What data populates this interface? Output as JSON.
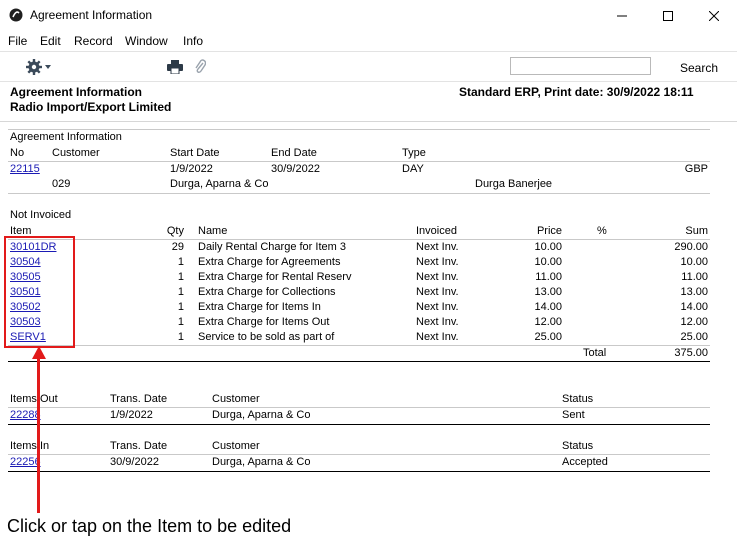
{
  "window": {
    "title": "Agreement Information"
  },
  "menu": [
    "File",
    "Edit",
    "Record",
    "Window",
    "Info"
  ],
  "toolbar": {
    "search_label": "Search",
    "search_value": ""
  },
  "header": {
    "left1": "Agreement Information",
    "left2": "Radio Import/Export Limited",
    "right": "Standard ERP, Print date: 30/9/2022 18:11"
  },
  "agreement": {
    "section_title": "Agreement Information",
    "cols": {
      "no": "No",
      "customer": "Customer",
      "start": "Start Date",
      "end": "End Date",
      "type": "Type"
    },
    "no": "22115",
    "start": "1/9/2022",
    "end": "30/9/2022",
    "type": "DAY",
    "currency": "GBP",
    "customer_code": "029",
    "customer_name": "Durga, Aparna & Co",
    "contact": "Durga Banerjee"
  },
  "not_invoiced": {
    "section_title": "Not Invoiced",
    "cols": {
      "item": "Item",
      "qty": "Qty",
      "name": "Name",
      "invoiced": "Invoiced",
      "price": "Price",
      "pct": "%",
      "sum": "Sum"
    },
    "rows": [
      {
        "item": "30101DR",
        "qty": "29",
        "name": "Daily Rental Charge for Item 3",
        "invoiced": "Next Inv.",
        "price": "10.00",
        "sum": "290.00"
      },
      {
        "item": "30504",
        "qty": "1",
        "name": "Extra Charge for Agreements",
        "invoiced": "Next Inv.",
        "price": "10.00",
        "sum": "10.00"
      },
      {
        "item": "30505",
        "qty": "1",
        "name": "Extra Charge for Rental Reserv",
        "invoiced": "Next Inv.",
        "price": "11.00",
        "sum": "11.00"
      },
      {
        "item": "30501",
        "qty": "1",
        "name": "Extra Charge for Collections",
        "invoiced": "Next Inv.",
        "price": "13.00",
        "sum": "13.00"
      },
      {
        "item": "30502",
        "qty": "1",
        "name": "Extra Charge for Items In",
        "invoiced": "Next Inv.",
        "price": "14.00",
        "sum": "14.00"
      },
      {
        "item": "30503",
        "qty": "1",
        "name": "Extra Charge for Items Out",
        "invoiced": "Next Inv.",
        "price": "12.00",
        "sum": "12.00"
      },
      {
        "item": "SERV1",
        "qty": "1",
        "name": "Service to be sold as part of",
        "invoiced": "Next Inv.",
        "price": "25.00",
        "sum": "25.00"
      }
    ],
    "total_label": "Total",
    "total_value": "375.00"
  },
  "items_out": {
    "cols": {
      "no": "Items Out",
      "date": "Trans. Date",
      "customer": "Customer",
      "status": "Status"
    },
    "row": {
      "no": "22288",
      "date": "1/9/2022",
      "customer": "Durga, Aparna & Co",
      "status": "Sent"
    }
  },
  "items_in": {
    "cols": {
      "no": "Items In",
      "date": "Trans. Date",
      "customer": "Customer",
      "status": "Status"
    },
    "row": {
      "no": "22256",
      "date": "30/9/2022",
      "customer": "Durga, Aparna & Co",
      "status": "Accepted"
    }
  },
  "annotation": {
    "caption": "Click or tap on the Item to be edited",
    "color": "#e21a1a"
  }
}
